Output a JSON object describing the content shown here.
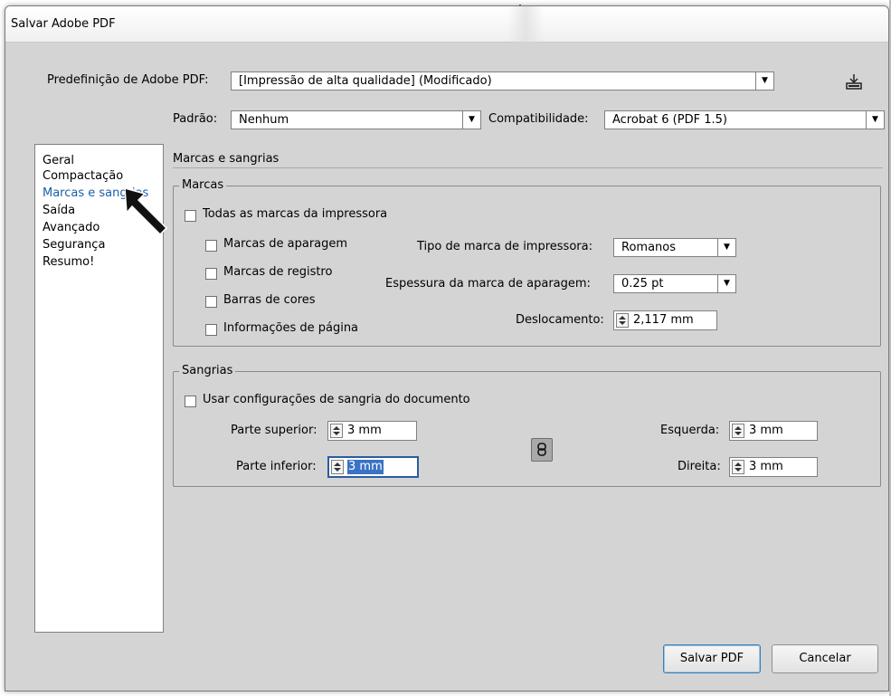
{
  "window": {
    "title": "Salvar Adobe PDF"
  },
  "preset": {
    "label": "Predefinição de Adobe PDF:",
    "value": "[Impressão de alta qualidade] (Modificado)",
    "save_icon": "save-preset-icon"
  },
  "standard": {
    "label": "Padrão:",
    "value": "Nenhum"
  },
  "compat": {
    "label": "Compatibilidade:",
    "value": "Acrobat 6 (PDF 1.5)"
  },
  "sidebar": {
    "items": [
      {
        "label": "Geral"
      },
      {
        "label": "Compactação"
      },
      {
        "label": "Marcas e sangrias",
        "selected": true
      },
      {
        "label": "Saída"
      },
      {
        "label": "Avançado"
      },
      {
        "label": "Segurança"
      },
      {
        "label": "Resumo!"
      }
    ]
  },
  "section": {
    "title": "Marcas e sangrias"
  },
  "marks": {
    "group_label": "Marcas",
    "all_marks": {
      "label": "Todas as marcas da impressora",
      "checked": false
    },
    "crop": {
      "label": "Marcas de aparagem",
      "checked": false
    },
    "registration": {
      "label": "Marcas de registro",
      "checked": false
    },
    "color_bars": {
      "label": "Barras de cores",
      "checked": false
    },
    "page_info": {
      "label": "Informações de página",
      "checked": false
    },
    "type": {
      "label": "Tipo de marca de impressora:",
      "value": "Romanos"
    },
    "weight": {
      "label": "Espessura da marca de aparagem:",
      "value": "0.25 pt"
    },
    "offset": {
      "label": "Deslocamento:",
      "value": "2,117 mm"
    }
  },
  "bleeds": {
    "group_label": "Sangrias",
    "use_doc": {
      "label": "Usar configurações de sangria do documento",
      "checked": false
    },
    "top": {
      "label": "Parte superior:",
      "value": "3 mm"
    },
    "bottom": {
      "label": "Parte inferior:",
      "value": "3 mm"
    },
    "left": {
      "label": "Esquerda:",
      "value": "3 mm"
    },
    "right": {
      "label": "Direita:",
      "value": "3 mm"
    },
    "link_icon": "chain-link-icon"
  },
  "buttons": {
    "save": "Salvar PDF",
    "cancel": "Cancelar"
  },
  "colors": {
    "dialog_bg": "#d4d4d4",
    "selection": "#3a73c4",
    "selected_text": "#1c5fa8"
  }
}
